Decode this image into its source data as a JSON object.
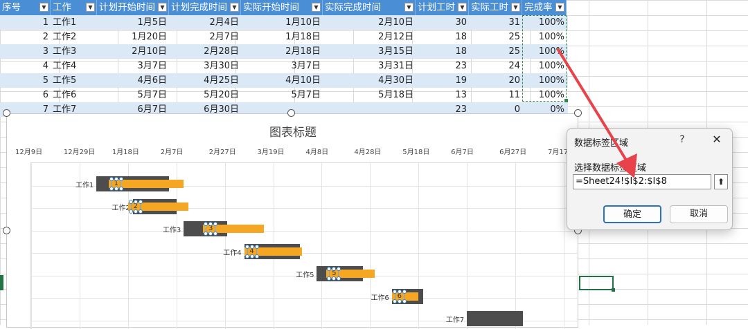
{
  "table": {
    "headers": [
      "序号",
      "工作",
      "计划开始时间",
      "计划完成时间",
      "实际开始时间",
      "实际完成时间",
      "计划工时",
      "实际工时",
      "完成率"
    ],
    "rows": [
      {
        "seq": "1",
        "task": "工作1",
        "plan_start": "1月5日",
        "plan_end": "2月4日",
        "act_start": "1月10日",
        "act_end": "2月10日",
        "plan_hours": "30",
        "act_hours": "31",
        "rate": "100%"
      },
      {
        "seq": "2",
        "task": "工作2",
        "plan_start": "1月20日",
        "plan_end": "2月7日",
        "act_start": "1月18日",
        "act_end": "2月12日",
        "plan_hours": "18",
        "act_hours": "25",
        "rate": "100%"
      },
      {
        "seq": "3",
        "task": "工作3",
        "plan_start": "2月10日",
        "plan_end": "2月28日",
        "act_start": "2月18日",
        "act_end": "3月15日",
        "plan_hours": "18",
        "act_hours": "25",
        "rate": "100%"
      },
      {
        "seq": "4",
        "task": "工作4",
        "plan_start": "3月7日",
        "plan_end": "3月30日",
        "act_start": "3月7日",
        "act_end": "3月31日",
        "plan_hours": "23",
        "act_hours": "24",
        "rate": "100%"
      },
      {
        "seq": "5",
        "task": "工作5",
        "plan_start": "4月6日",
        "plan_end": "4月25日",
        "act_start": "4月10日",
        "act_end": "4月30日",
        "plan_hours": "19",
        "act_hours": "20",
        "rate": "100%"
      },
      {
        "seq": "6",
        "task": "工作6",
        "plan_start": "5月7日",
        "plan_end": "5月20日",
        "act_start": "5月7日",
        "act_end": "5月18日",
        "plan_hours": "13",
        "act_hours": "11",
        "rate": "100%"
      },
      {
        "seq": "7",
        "task": "工作7",
        "plan_start": "6月7日",
        "plan_end": "6月30日",
        "act_start": "",
        "act_end": "",
        "plan_hours": "23",
        "act_hours": "0",
        "rate": "0%"
      }
    ]
  },
  "chart_data": {
    "type": "bar",
    "title": "图表标题",
    "x_ticks": [
      "12月9日",
      "12月29日",
      "1月18日",
      "2月7日",
      "2月27日",
      "3月19日",
      "4月8日",
      "4月28日",
      "5月18日",
      "6月7日",
      "6月27日",
      "7月17日"
    ],
    "categories": [
      "工作1",
      "工作2",
      "工作3",
      "工作4",
      "工作5",
      "工作6",
      "工作7"
    ],
    "series": [
      {
        "values": [
          [
            "1月5日",
            "2月4日"
          ],
          [
            "1月20日",
            "2月7日"
          ],
          [
            "2月10日",
            "2月28日"
          ],
          [
            "3月7日",
            "3月30日"
          ],
          [
            "4月6日",
            "4月25日"
          ],
          [
            "5月7日",
            "5月20日"
          ],
          [
            "6月7日",
            "6月30日"
          ]
        ],
        "color": "#4d4d4d"
      },
      {
        "values": [
          [
            "1月10日",
            "2月10日"
          ],
          [
            "1月18日",
            "2月12日"
          ],
          [
            "2月18日",
            "3月15日"
          ],
          [
            "3月7日",
            "3月31日"
          ],
          [
            "4月10日",
            "4月30日"
          ],
          [
            "5月7日",
            "5月18日"
          ],
          null
        ],
        "color": "#f5a623"
      }
    ],
    "data_labels": [
      "1",
      "2",
      "3",
      "4",
      "5",
      "6"
    ],
    "grid": true
  },
  "dialog": {
    "title": "数据标签区域",
    "help": "?",
    "close": "✕",
    "prompt": "选择数据标签区域",
    "range_value": "=Sheet24!$I$2:$I$8",
    "collapse_icon": "⬆",
    "ok_label": "确定",
    "cancel_label": "取消"
  },
  "colors": {
    "header": "#4a8fd6",
    "band": "#dbe8f6",
    "accent_arrow": "#e8424a",
    "selection": "#217346"
  }
}
